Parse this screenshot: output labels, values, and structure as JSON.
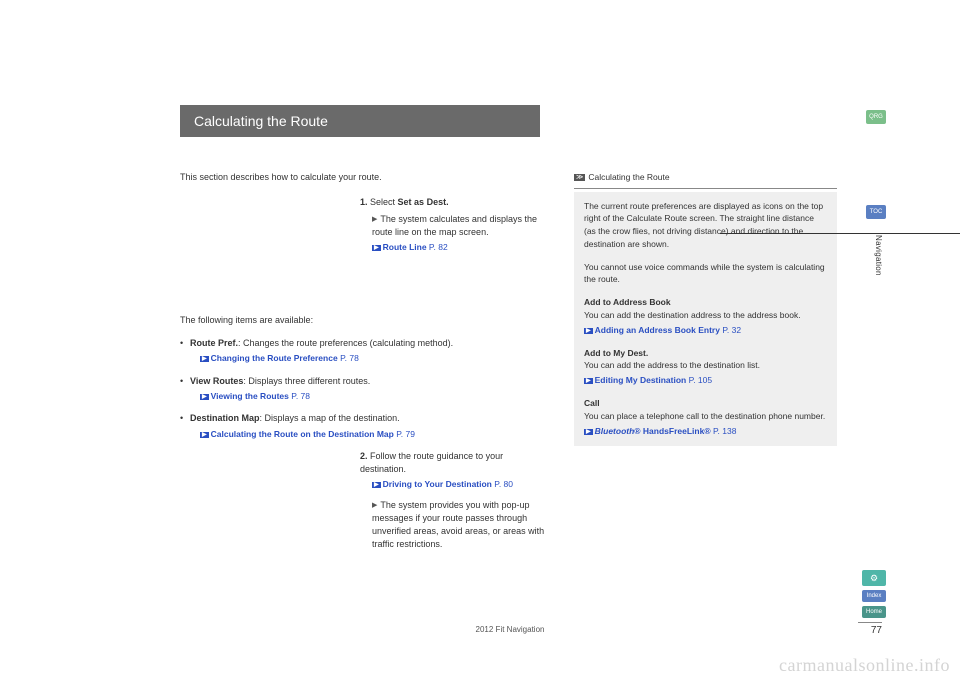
{
  "title": "Calculating the Route",
  "intro": "This section describes how to calculate your route.",
  "step1": {
    "num": "1.",
    "text": "Select ",
    "bold": "Set as Dest."
  },
  "step1_sub": "The system calculates and displays the route line on the map screen.",
  "step1_link": {
    "label": "Route Line",
    "page": "P. 82"
  },
  "avail_intro": "The following items are available:",
  "bullets": [
    {
      "bold": "Route Pref.",
      "text": ": Changes the route preferences (calculating method).",
      "link": {
        "label": "Changing the Route Preference",
        "page": "P. 78"
      }
    },
    {
      "bold": "View Routes",
      "text": ": Displays three different routes.",
      "link": {
        "label": "Viewing the Routes",
        "page": "P. 78"
      }
    },
    {
      "bold": "Destination Map",
      "text": ": Displays a map of the destination.",
      "link": {
        "label": "Calculating the Route on the Destination Map",
        "page": "P. 79"
      }
    }
  ],
  "step2": {
    "num": "2.",
    "text": "Follow the route guidance to your destination.",
    "link": {
      "label": "Driving to Your Destination",
      "page": "P. 80"
    }
  },
  "step2_sub": "The system provides you with pop-up messages if your route passes through unverified areas, avoid areas, or areas with traffic restrictions.",
  "sidebar": {
    "title": "Calculating the Route",
    "p1": "The current route preferences are displayed as icons on the top right of the Calculate Route screen. The straight line distance (as the crow flies, not driving distance) and direction to the destination are shown.",
    "p2": "You cannot use voice commands while the system is calculating the route.",
    "addr_h": "Add to Address Book",
    "addr_t": "You can add the destination address to the address book.",
    "addr_link": {
      "label": "Adding an Address Book Entry",
      "page": "P. 32"
    },
    "dest_h": "Add to My Dest.",
    "dest_t": "You can add the address to the destination list.",
    "dest_link": {
      "label": "Editing My Destination",
      "page": "P. 105"
    },
    "call_h": "Call",
    "call_t": "You can place a telephone call to the destination phone number.",
    "call_link": {
      "label_pre": "Bluetooth",
      "label_post": "® HandsFreeLink®",
      "page": "P. 138"
    }
  },
  "tabs": {
    "qrg": "QRG",
    "toc": "TOC",
    "nav": "Navigation",
    "voice": "⚙",
    "index": "Index",
    "home": "Home"
  },
  "page_number": "77",
  "footer": "2012 Fit Navigation",
  "watermark": "carmanualsonline.info"
}
